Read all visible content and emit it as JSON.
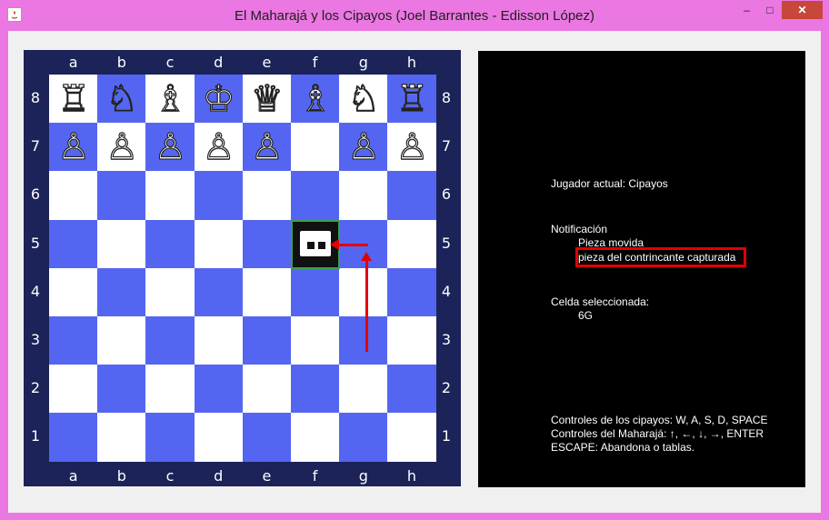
{
  "window": {
    "title": "El Maharajá y los Cipayos (Joel Barrantes - Edisson López)",
    "minimize_glyph": "–",
    "maximize_glyph": "□",
    "close_glyph": "✕"
  },
  "board": {
    "files": [
      "a",
      "b",
      "c",
      "d",
      "e",
      "f",
      "g",
      "h"
    ],
    "ranks": [
      "8",
      "7",
      "6",
      "5",
      "4",
      "3",
      "2",
      "1"
    ],
    "light_color": "#ffffff",
    "dark_color": "#5466f1",
    "frame_color": "#1b2358",
    "pieces": {
      "rank8": [
        {
          "file": "a",
          "glyph": "♖",
          "name": "rook"
        },
        {
          "file": "b",
          "glyph": "♘",
          "name": "knight"
        },
        {
          "file": "c",
          "glyph": "♗",
          "name": "bishop"
        },
        {
          "file": "d",
          "glyph": "♔",
          "name": "king"
        },
        {
          "file": "e",
          "glyph": "♕",
          "name": "queen"
        },
        {
          "file": "f",
          "glyph": "♗",
          "name": "bishop"
        },
        {
          "file": "g",
          "glyph": "♘",
          "name": "knight"
        },
        {
          "file": "h",
          "glyph": "♖",
          "name": "rook"
        }
      ],
      "rank7": [
        {
          "file": "a",
          "glyph": "♙"
        },
        {
          "file": "b",
          "glyph": "♙"
        },
        {
          "file": "c",
          "glyph": "♙"
        },
        {
          "file": "d",
          "glyph": "♙"
        },
        {
          "file": "e",
          "glyph": "♙"
        },
        {
          "file": "g",
          "glyph": "♙"
        },
        {
          "file": "h",
          "glyph": "♙"
        }
      ],
      "maharaja": {
        "square": "f5",
        "icon": "sepoy-icon"
      }
    }
  },
  "panel": {
    "current_player": "Jugador actual: Cipayos",
    "notification_title": "Notificación",
    "notification_line1": "Pieza movida",
    "notification_line2": "pieza del contrincante capturada",
    "selected_title": "Celda seleccionada:",
    "selected_value": "6G",
    "controls_sepoys": "Controles de los cipayos:  W, A, S, D, SPACE",
    "controls_maharaja": "Controles del Maharajá:    ↑, ←, ↓, →, ENTER",
    "controls_escape": "ESCAPE: Abandona o tablas.",
    "background": "#000000",
    "highlight_color": "#e30000"
  }
}
